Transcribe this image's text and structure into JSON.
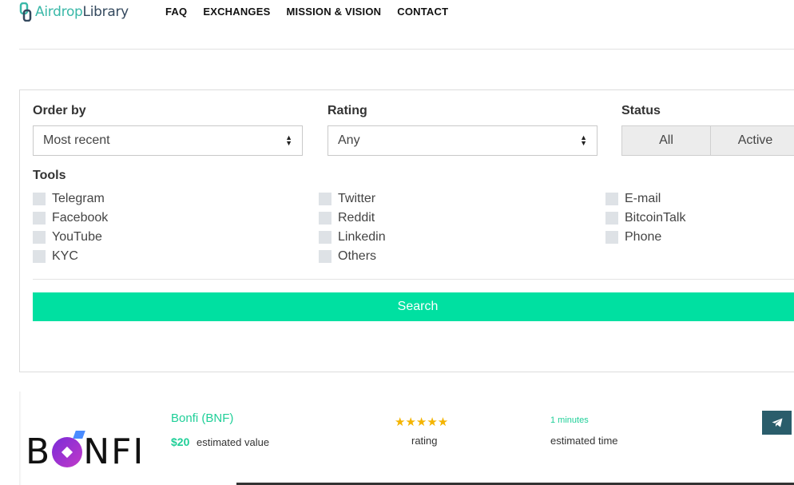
{
  "brand": {
    "name_part1": "Airdrop",
    "name_part2": "Library"
  },
  "nav": [
    "FAQ",
    "EXCHANGES",
    "MISSION & VISION",
    "CONTACT"
  ],
  "filters": {
    "order_by": {
      "label": "Order by",
      "value": "Most recent"
    },
    "rating": {
      "label": "Rating",
      "value": "Any"
    },
    "status": {
      "label": "Status",
      "options": [
        "All",
        "Active"
      ]
    },
    "tools": {
      "label": "Tools",
      "items": [
        "Telegram",
        "Facebook",
        "YouTube",
        "KYC",
        "Twitter",
        "Reddit",
        "Linkedin",
        "Others",
        "E-mail",
        "BitcoinTalk",
        "Phone"
      ]
    },
    "search_label": "Search"
  },
  "airdrop": {
    "logo_text_left": "B",
    "logo_text_right": "NFI",
    "title": "Bonfi (BNF)",
    "value": "$20",
    "value_label": "estimated value",
    "stars": "★★★★★",
    "rating_out_of_5": 5,
    "rating_label": "rating",
    "time": "1 minutes",
    "time_label": "estimated time"
  },
  "colors": {
    "accent": "#00e0a1",
    "accent_text": "#1fcf98",
    "telegram_button": "#2a5d6b",
    "star": "#f4b400"
  }
}
